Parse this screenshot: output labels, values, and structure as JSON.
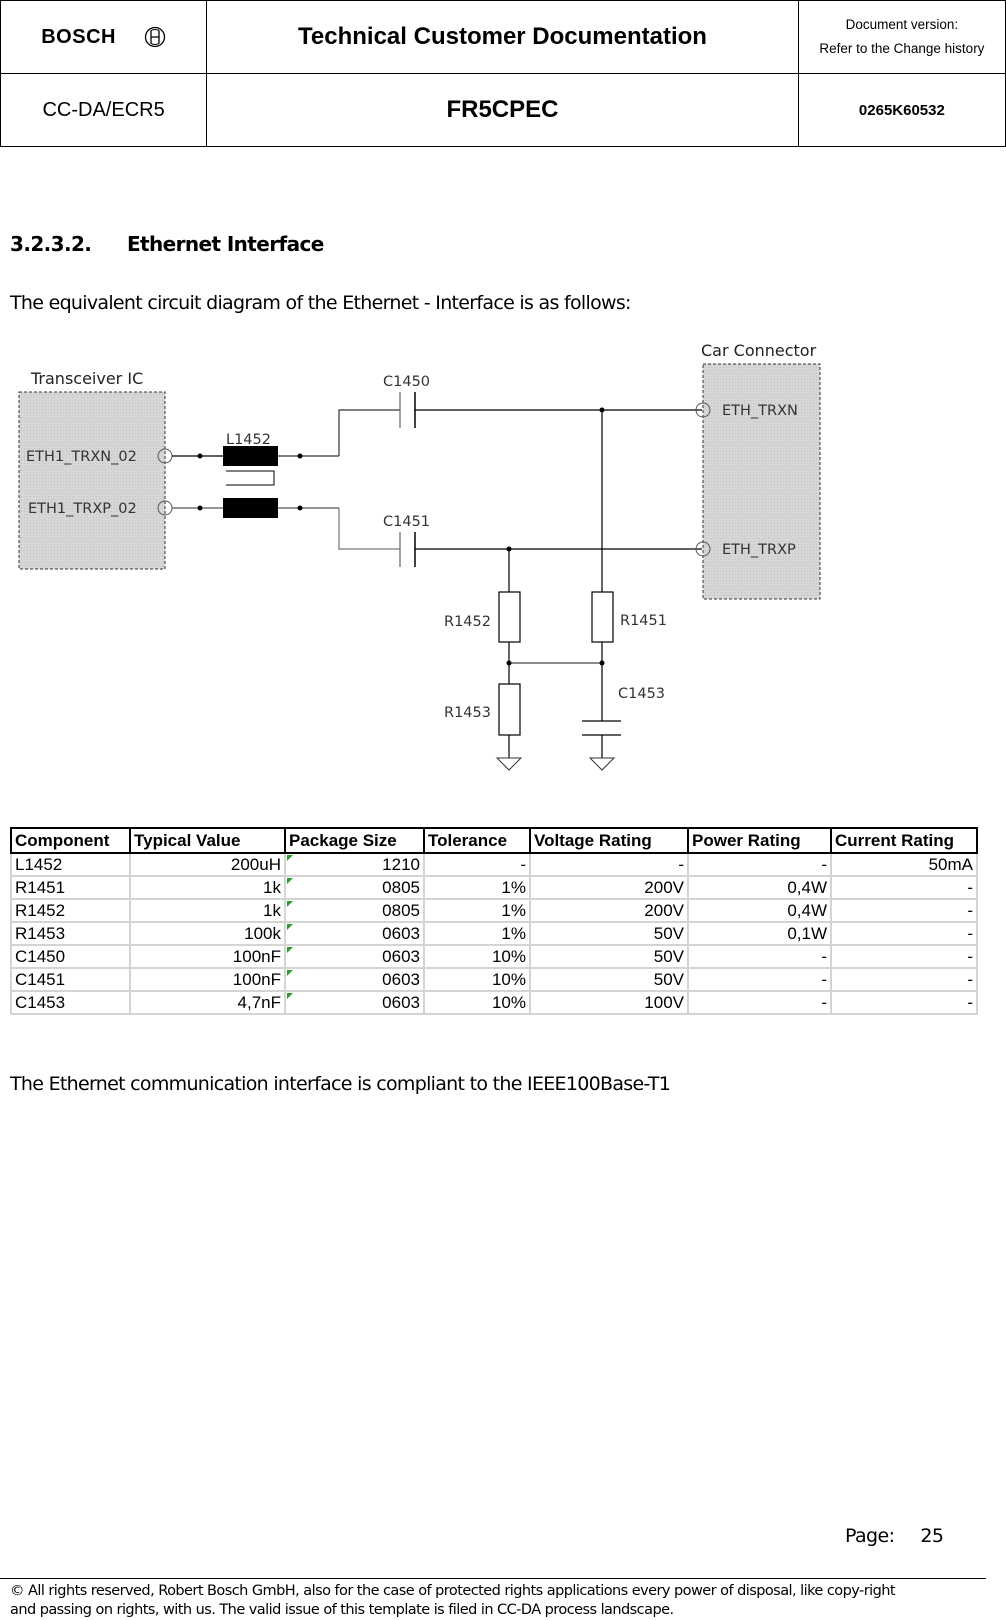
{
  "header": {
    "logo_text": "BOSCH",
    "title": "Technical Customer Documentation",
    "version_label": "Document version:",
    "version_value": "Refer to the Change history",
    "department": "CC-DA/ECR5",
    "product": "FR5CPEC",
    "document_number": "0265K60532"
  },
  "section": {
    "number": "3.2.3.2.",
    "title": "Ethernet Interface",
    "intro": "The equivalent circuit diagram of the Ethernet - Interface is as follows:"
  },
  "diagram": {
    "transceiver_label": "Transceiver IC",
    "transceiver_pins": [
      "ETH1_TRXN_02",
      "ETH1_TRXP_02"
    ],
    "connector_label": "Car Connector",
    "connector_pins": [
      "ETH_TRXN",
      "ETH_TRXP"
    ],
    "components": {
      "choke": "L1452",
      "cap_n": "C1450",
      "cap_p": "C1451",
      "res_a": "R1452",
      "res_b": "R1451",
      "res_c": "R1453",
      "cap_gnd": "C1453"
    }
  },
  "table": {
    "headers": [
      "Component",
      "Typical Value",
      "Package Size",
      "Tolerance",
      "Voltage Rating",
      "Power Rating",
      "Current Rating"
    ],
    "rows": [
      [
        "L1452",
        "200uH",
        "1210",
        "-",
        "-",
        "-",
        "50mA"
      ],
      [
        "R1451",
        "1k",
        "0805",
        "1%",
        "200V",
        "0,4W",
        "-"
      ],
      [
        "R1452",
        "1k",
        "0805",
        "1%",
        "200V",
        "0,4W",
        "-"
      ],
      [
        "R1453",
        "100k",
        "0603",
        "1%",
        "50V",
        "0,1W",
        "-"
      ],
      [
        "C1450",
        "100nF",
        "0603",
        "10%",
        "50V",
        "-",
        "-"
      ],
      [
        "C1451",
        "100nF",
        "0603",
        "10%",
        "50V",
        "-",
        "-"
      ],
      [
        "C1453",
        "4,7nF",
        "0603",
        "10%",
        "100V",
        "-",
        "-"
      ]
    ]
  },
  "compliance_text": "The Ethernet communication interface is compliant to the IEEE100Base-T1",
  "page": {
    "label": "Page:",
    "number": "25"
  },
  "footer": {
    "line1": "© All rights reserved, Robert Bosch GmbH, also for the case of protected rights applications every power of disposal, like copy-right",
    "line2": "and passing on rights, with us. The valid issue of this template is filed in CC-DA process landscape."
  }
}
